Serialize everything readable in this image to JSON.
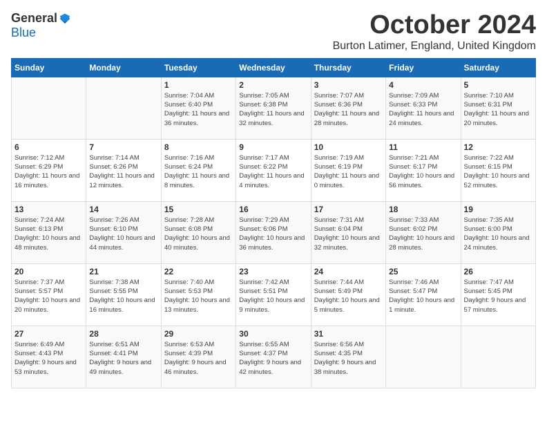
{
  "logo": {
    "general": "General",
    "blue": "Blue"
  },
  "title": "October 2024",
  "location": "Burton Latimer, England, United Kingdom",
  "days_of_week": [
    "Sunday",
    "Monday",
    "Tuesday",
    "Wednesday",
    "Thursday",
    "Friday",
    "Saturday"
  ],
  "weeks": [
    [
      {
        "day": "",
        "info": ""
      },
      {
        "day": "",
        "info": ""
      },
      {
        "day": "1",
        "info": "Sunrise: 7:04 AM\nSunset: 6:40 PM\nDaylight: 11 hours and 36 minutes."
      },
      {
        "day": "2",
        "info": "Sunrise: 7:05 AM\nSunset: 6:38 PM\nDaylight: 11 hours and 32 minutes."
      },
      {
        "day": "3",
        "info": "Sunrise: 7:07 AM\nSunset: 6:36 PM\nDaylight: 11 hours and 28 minutes."
      },
      {
        "day": "4",
        "info": "Sunrise: 7:09 AM\nSunset: 6:33 PM\nDaylight: 11 hours and 24 minutes."
      },
      {
        "day": "5",
        "info": "Sunrise: 7:10 AM\nSunset: 6:31 PM\nDaylight: 11 hours and 20 minutes."
      }
    ],
    [
      {
        "day": "6",
        "info": "Sunrise: 7:12 AM\nSunset: 6:29 PM\nDaylight: 11 hours and 16 minutes."
      },
      {
        "day": "7",
        "info": "Sunrise: 7:14 AM\nSunset: 6:26 PM\nDaylight: 11 hours and 12 minutes."
      },
      {
        "day": "8",
        "info": "Sunrise: 7:16 AM\nSunset: 6:24 PM\nDaylight: 11 hours and 8 minutes."
      },
      {
        "day": "9",
        "info": "Sunrise: 7:17 AM\nSunset: 6:22 PM\nDaylight: 11 hours and 4 minutes."
      },
      {
        "day": "10",
        "info": "Sunrise: 7:19 AM\nSunset: 6:19 PM\nDaylight: 11 hours and 0 minutes."
      },
      {
        "day": "11",
        "info": "Sunrise: 7:21 AM\nSunset: 6:17 PM\nDaylight: 10 hours and 56 minutes."
      },
      {
        "day": "12",
        "info": "Sunrise: 7:22 AM\nSunset: 6:15 PM\nDaylight: 10 hours and 52 minutes."
      }
    ],
    [
      {
        "day": "13",
        "info": "Sunrise: 7:24 AM\nSunset: 6:13 PM\nDaylight: 10 hours and 48 minutes."
      },
      {
        "day": "14",
        "info": "Sunrise: 7:26 AM\nSunset: 6:10 PM\nDaylight: 10 hours and 44 minutes."
      },
      {
        "day": "15",
        "info": "Sunrise: 7:28 AM\nSunset: 6:08 PM\nDaylight: 10 hours and 40 minutes."
      },
      {
        "day": "16",
        "info": "Sunrise: 7:29 AM\nSunset: 6:06 PM\nDaylight: 10 hours and 36 minutes."
      },
      {
        "day": "17",
        "info": "Sunrise: 7:31 AM\nSunset: 6:04 PM\nDaylight: 10 hours and 32 minutes."
      },
      {
        "day": "18",
        "info": "Sunrise: 7:33 AM\nSunset: 6:02 PM\nDaylight: 10 hours and 28 minutes."
      },
      {
        "day": "19",
        "info": "Sunrise: 7:35 AM\nSunset: 6:00 PM\nDaylight: 10 hours and 24 minutes."
      }
    ],
    [
      {
        "day": "20",
        "info": "Sunrise: 7:37 AM\nSunset: 5:57 PM\nDaylight: 10 hours and 20 minutes."
      },
      {
        "day": "21",
        "info": "Sunrise: 7:38 AM\nSunset: 5:55 PM\nDaylight: 10 hours and 16 minutes."
      },
      {
        "day": "22",
        "info": "Sunrise: 7:40 AM\nSunset: 5:53 PM\nDaylight: 10 hours and 13 minutes."
      },
      {
        "day": "23",
        "info": "Sunrise: 7:42 AM\nSunset: 5:51 PM\nDaylight: 10 hours and 9 minutes."
      },
      {
        "day": "24",
        "info": "Sunrise: 7:44 AM\nSunset: 5:49 PM\nDaylight: 10 hours and 5 minutes."
      },
      {
        "day": "25",
        "info": "Sunrise: 7:46 AM\nSunset: 5:47 PM\nDaylight: 10 hours and 1 minute."
      },
      {
        "day": "26",
        "info": "Sunrise: 7:47 AM\nSunset: 5:45 PM\nDaylight: 9 hours and 57 minutes."
      }
    ],
    [
      {
        "day": "27",
        "info": "Sunrise: 6:49 AM\nSunset: 4:43 PM\nDaylight: 9 hours and 53 minutes."
      },
      {
        "day": "28",
        "info": "Sunrise: 6:51 AM\nSunset: 4:41 PM\nDaylight: 9 hours and 49 minutes."
      },
      {
        "day": "29",
        "info": "Sunrise: 6:53 AM\nSunset: 4:39 PM\nDaylight: 9 hours and 46 minutes."
      },
      {
        "day": "30",
        "info": "Sunrise: 6:55 AM\nSunset: 4:37 PM\nDaylight: 9 hours and 42 minutes."
      },
      {
        "day": "31",
        "info": "Sunrise: 6:56 AM\nSunset: 4:35 PM\nDaylight: 9 hours and 38 minutes."
      },
      {
        "day": "",
        "info": ""
      },
      {
        "day": "",
        "info": ""
      }
    ]
  ]
}
